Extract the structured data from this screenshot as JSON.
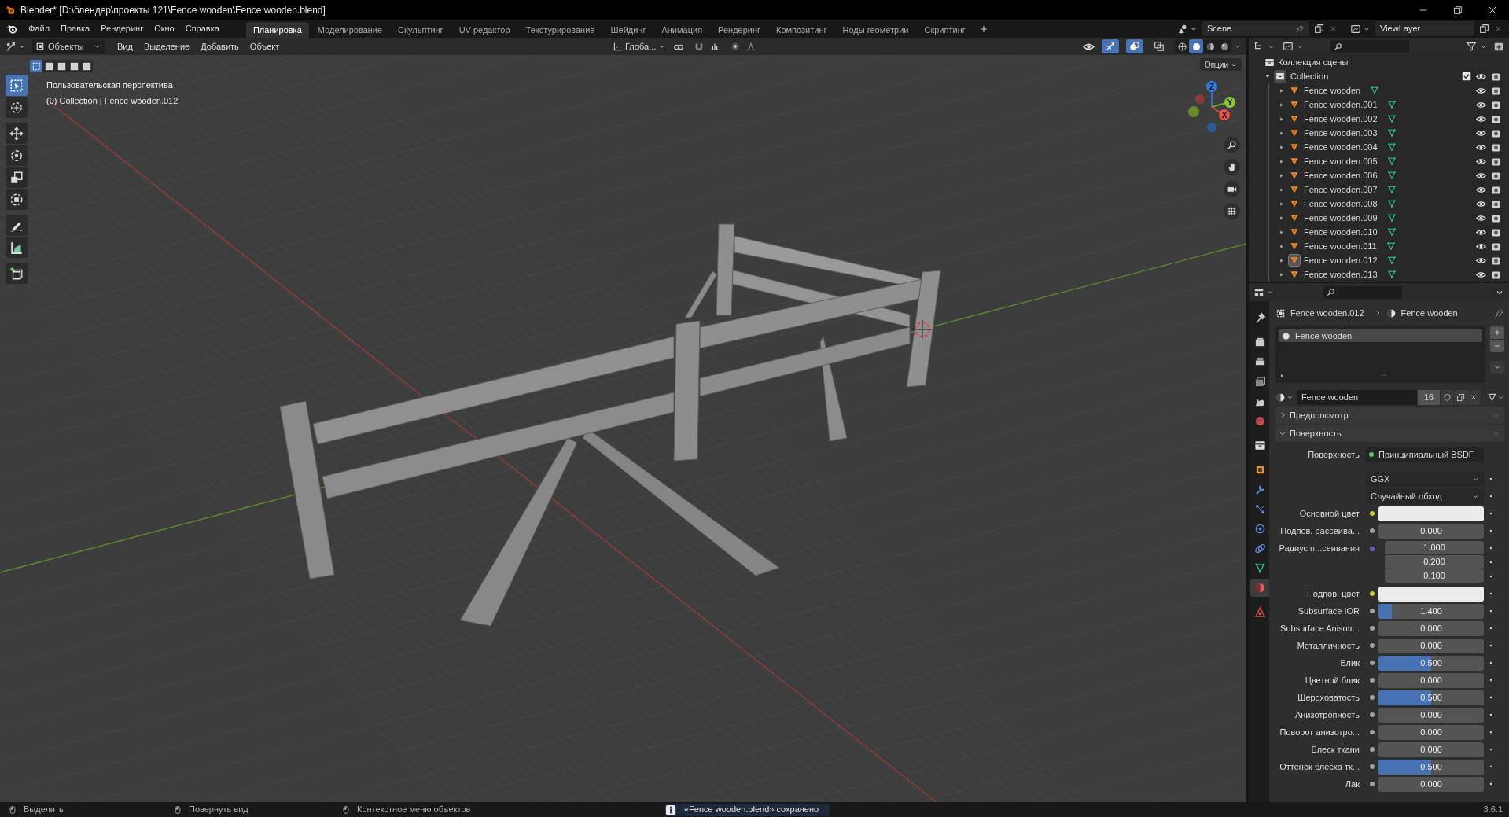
{
  "window": {
    "title": "Blender* [D:\\блендер\\проекты 121\\Fence wooden\\Fence wooden.blend]"
  },
  "menu": [
    "Файл",
    "Правка",
    "Рендеринг",
    "Окно",
    "Справка"
  ],
  "workspaces": [
    {
      "label": "Планировка",
      "selected": true
    },
    {
      "label": "Моделирование",
      "selected": false
    },
    {
      "label": "Скульптинг",
      "selected": false
    },
    {
      "label": "UV-редактор",
      "selected": false
    },
    {
      "label": "Текстурирование",
      "selected": false
    },
    {
      "label": "Шейдинг",
      "selected": false
    },
    {
      "label": "Анимация",
      "selected": false
    },
    {
      "label": "Рендеринг",
      "selected": false
    },
    {
      "label": "Композитинг",
      "selected": false
    },
    {
      "label": "Ноды геометрии",
      "selected": false
    },
    {
      "label": "Скриптинг",
      "selected": false
    }
  ],
  "scene": "Scene",
  "view_layer": "ViewLayer",
  "viewport_header": {
    "mode": "Объекты",
    "menu": [
      "Вид",
      "Выделение",
      "Добавить",
      "Объект"
    ],
    "orientation": "Глоба...",
    "toggles": [
      {
        "kind": "gizmos",
        "on": true
      },
      {
        "kind": "overlays",
        "on": true
      },
      {
        "kind": "xray",
        "on": false
      }
    ],
    "shading": [
      {
        "kind": "wireframe",
        "selected": false
      },
      {
        "kind": "solid",
        "selected": true
      },
      {
        "kind": "material",
        "selected": false
      },
      {
        "kind": "rendered",
        "selected": false
      }
    ]
  },
  "viewport": {
    "view_name": "Пользовательская перспектива",
    "info": "(0) Collection | Fence wooden.012",
    "options": "Опции",
    "select_modes": [
      {
        "selected": true
      },
      {
        "selected": false
      },
      {
        "selected": false
      },
      {
        "selected": false
      },
      {
        "selected": false
      }
    ],
    "tools": [
      {
        "kind": "select",
        "selected": true
      },
      {
        "kind": "cursor",
        "selected": false
      },
      {
        "kind": "move",
        "selected": false
      },
      {
        "kind": "rotate",
        "selected": false
      },
      {
        "kind": "scale",
        "selected": false
      },
      {
        "kind": "transform",
        "selected": false
      },
      {
        "kind": "annotate",
        "selected": false
      },
      {
        "kind": "measure",
        "selected": false
      },
      {
        "kind": "add_cube",
        "selected": false
      }
    ],
    "gizmo": {
      "x": "X",
      "y": "Y",
      "z": "Z"
    }
  },
  "outliner": {
    "root": "Коллекция сцены",
    "collection": {
      "label": "Collection",
      "expanded": true,
      "checked": true,
      "children": [
        {
          "label": "Fence wooden",
          "expanded": false,
          "selected": false
        },
        {
          "label": "Fence wooden.001",
          "expanded": false,
          "selected": false
        },
        {
          "label": "Fence wooden.002",
          "expanded": false,
          "selected": false
        },
        {
          "label": "Fence wooden.003",
          "expanded": false,
          "selected": false
        },
        {
          "label": "Fence wooden.004",
          "expanded": false,
          "selected": false
        },
        {
          "label": "Fence wooden.005",
          "expanded": false,
          "selected": false
        },
        {
          "label": "Fence wooden.006",
          "expanded": false,
          "selected": false
        },
        {
          "label": "Fence wooden.007",
          "expanded": false,
          "selected": false
        },
        {
          "label": "Fence wooden.008",
          "expanded": false,
          "selected": false
        },
        {
          "label": "Fence wooden.009",
          "expanded": false,
          "selected": false
        },
        {
          "label": "Fence wooden.010",
          "expanded": false,
          "selected": false
        },
        {
          "label": "Fence wooden.011",
          "expanded": false,
          "selected": false
        },
        {
          "label": "Fence wooden.012",
          "expanded": false,
          "selected": true
        },
        {
          "label": "Fence wooden.013",
          "expanded": false,
          "selected": false
        }
      ]
    }
  },
  "properties": {
    "tabs": [
      {
        "kind": "tool",
        "selected": false
      },
      {
        "kind": "render",
        "selected": false
      },
      {
        "kind": "output",
        "selected": false
      },
      {
        "kind": "view_layer",
        "selected": false
      },
      {
        "kind": "scene",
        "selected": false
      },
      {
        "kind": "world",
        "selected": false
      },
      {
        "kind": "collection",
        "selected": false
      },
      {
        "kind": "object",
        "selected": false
      },
      {
        "kind": "modifiers",
        "selected": false
      },
      {
        "kind": "particles",
        "selected": false
      },
      {
        "kind": "physics",
        "selected": false
      },
      {
        "kind": "constraints",
        "selected": false
      },
      {
        "kind": "data",
        "selected": false
      },
      {
        "kind": "material",
        "selected": true
      },
      {
        "kind": "texture",
        "selected": false
      }
    ],
    "breadcrumb": [
      "Fence wooden.012",
      "Fence wooden"
    ],
    "slots": [
      {
        "label": "Fence wooden",
        "selected": true
      }
    ],
    "material": {
      "name": "Fence wooden",
      "users": "16"
    },
    "panels": [
      {
        "label": "Предпросмотр",
        "expanded": false
      },
      {
        "label": "Поверхность",
        "expanded": true,
        "fields": [
          {
            "kind": "shader",
            "label": "Поверхность",
            "value": "Принципиальный BSDF",
            "color": "#63c763"
          },
          {
            "kind": "dropdown",
            "value": "GGX"
          },
          {
            "kind": "dropdown",
            "value": "Случайный обход"
          },
          {
            "kind": "swatch",
            "label": "Основной цвет",
            "color": "#c7c729"
          },
          {
            "kind": "slider",
            "label": "Подпов. рассеива...",
            "value": "0.000",
            "color": "#a1a1a1"
          },
          {
            "kind": "vector",
            "label": "Радиус п...сеивания",
            "values": [
              "1.000",
              "0.200",
              "0.100"
            ],
            "color": "#6363c7"
          },
          {
            "kind": "swatch",
            "label": "Подпов. цвет",
            "color": "#c7c729"
          },
          {
            "kind": "slider",
            "label": "Subsurface IOR",
            "value": "1.400",
            "level": 0.13,
            "color": "#a1a1a1"
          },
          {
            "kind": "slider",
            "label": "Subsurface Anisotr...",
            "value": "0.000",
            "color": "#a1a1a1"
          },
          {
            "kind": "slider",
            "label": "Металличность",
            "value": "0.000",
            "color": "#a1a1a1"
          },
          {
            "kind": "slider",
            "label": "Блик",
            "value": "0.500",
            "level": 0.5,
            "color": "#a1a1a1"
          },
          {
            "kind": "slider",
            "label": "Цветной блик",
            "value": "0.000",
            "color": "#a1a1a1"
          },
          {
            "kind": "slider",
            "label": "Шероховатость",
            "value": "0.500",
            "level": 0.5,
            "color": "#a1a1a1"
          },
          {
            "kind": "slider",
            "label": "Анизотропность",
            "value": "0.000",
            "color": "#a1a1a1"
          },
          {
            "kind": "slider",
            "label": "Поворот анизотро...",
            "value": "0.000",
            "color": "#a1a1a1"
          },
          {
            "kind": "slider",
            "label": "Блеск ткани",
            "value": "0.000",
            "color": "#a1a1a1"
          },
          {
            "kind": "slider",
            "label": "Оттенок блеска тк...",
            "value": "0.500",
            "level": 0.5,
            "color": "#a1a1a1"
          },
          {
            "kind": "slider",
            "label": "Лак",
            "value": "0.000",
            "color": "#a1a1a1"
          }
        ]
      }
    ]
  },
  "status_bar": {
    "hints": [
      "Выделить",
      "Повернуть вид",
      "Контекстное меню объектов"
    ],
    "notice": "«Fence wooden.blend» сохранено",
    "version": "3.6.1"
  }
}
